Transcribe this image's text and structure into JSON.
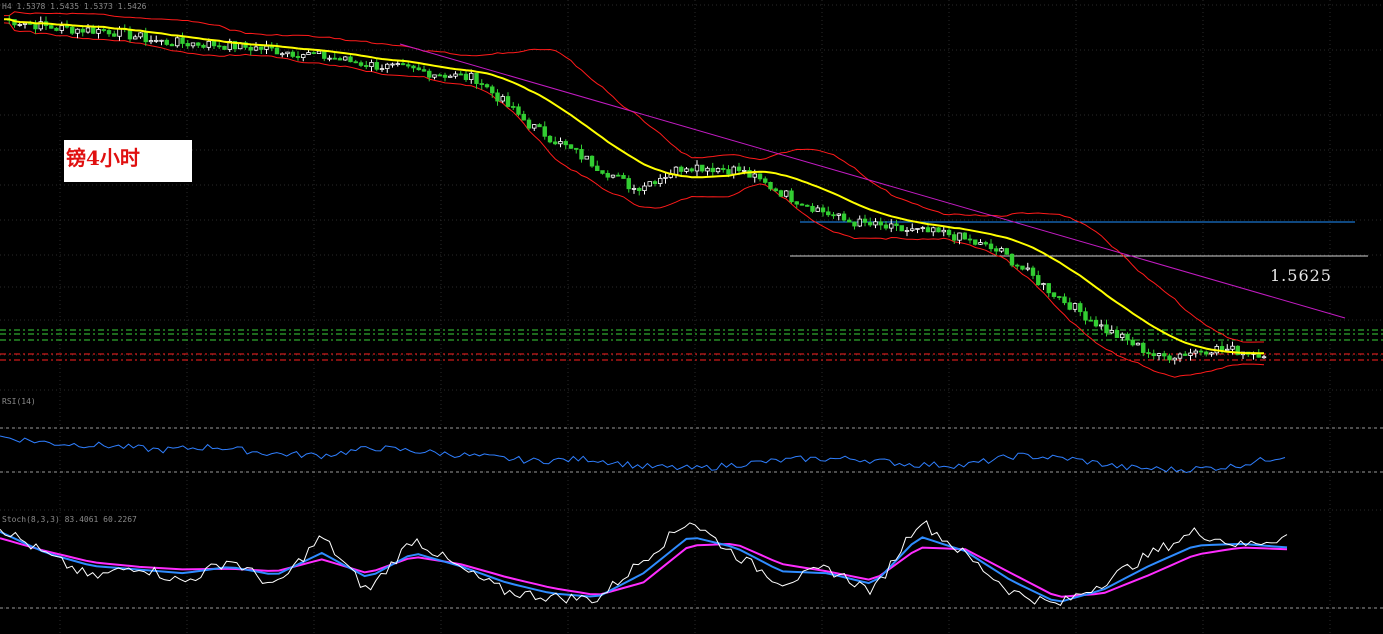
{
  "annotation": {
    "label": "镑4小时",
    "price_label": "1.5625"
  },
  "headers": {
    "main": "H4  1.5378 1.5435 1.5373 1.5426",
    "rsi": "RSI(14)",
    "stoch": "Stoch(8,3,3) 83.4061 60.2267"
  },
  "colors": {
    "candle_up": "#ffffff",
    "candle_down": "#32cd32",
    "moving_average": "#ffff00",
    "bollinger_bands": "#ff1a1a",
    "trendline": "#c21bc2",
    "horizontal_level_blue": "#1e90ff",
    "horizontal_level_white": "#d0d0d0",
    "rsi_line": "#2f7fff",
    "stoch_main": "#ffffff",
    "stoch_signal_1": "#2f8cff",
    "stoch_signal_2": "#ff2cff",
    "level_green": "#3ad23a",
    "level_red": "#ff2020",
    "grid": "#2a2a2a"
  },
  "chart_data": [
    {
      "type": "candlestick",
      "panel": "price",
      "indicators": [
        "moving average",
        "bollinger bands",
        "trendline",
        "horizontal levels"
      ],
      "trend": [
        {
          "x": 0,
          "close": 1.616
        },
        {
          "x": 10,
          "close": 1.614
        },
        {
          "x": 20,
          "close": 1.6135
        },
        {
          "x": 30,
          "close": 1.611
        },
        {
          "x": 40,
          "close": 1.6105
        },
        {
          "x": 50,
          "close": 1.6095
        },
        {
          "x": 60,
          "close": 1.608
        },
        {
          "x": 70,
          "close": 1.606
        },
        {
          "x": 80,
          "close": 1.6045
        },
        {
          "x": 90,
          "close": 1.603
        },
        {
          "x": 100,
          "close": 1.593
        },
        {
          "x": 110,
          "close": 1.586
        },
        {
          "x": 120,
          "close": 1.579
        },
        {
          "x": 130,
          "close": 1.584
        },
        {
          "x": 140,
          "close": 1.583
        },
        {
          "x": 150,
          "close": 1.577
        },
        {
          "x": 160,
          "close": 1.572
        },
        {
          "x": 170,
          "close": 1.57
        },
        {
          "x": 180,
          "close": 1.569
        },
        {
          "x": 190,
          "close": 1.565
        },
        {
          "x": 200,
          "close": 1.556
        },
        {
          "x": 210,
          "close": 1.548
        },
        {
          "x": 220,
          "close": 1.542
        },
        {
          "x": 230,
          "close": 1.544
        },
        {
          "x": 240,
          "close": 1.543
        }
      ],
      "price_label": 1.5625
    },
    {
      "type": "line",
      "panel": "rsi",
      "values": [
        62,
        56,
        54,
        50,
        53,
        47,
        45,
        52,
        48,
        44,
        40,
        42,
        35,
        33,
        38,
        42,
        42,
        37,
        36,
        45,
        42,
        34,
        32,
        35,
        45
      ]
    },
    {
      "type": "line",
      "panel": "stochastic",
      "series": [
        {
          "values": [
            90,
            60,
            35,
            48,
            30,
            55,
            25,
            80,
            20,
            78,
            45,
            20,
            14,
            12,
            55,
            98,
            60,
            30,
            45,
            20,
            98,
            60,
            20,
            5,
            30,
            60,
            85,
            70,
            80
          ]
        },
        {
          "values": [
            85,
            62,
            48,
            44,
            40,
            47,
            38,
            62,
            35,
            62,
            48,
            30,
            18,
            14,
            40,
            80,
            68,
            42,
            40,
            28,
            80,
            64,
            32,
            8,
            22,
            48,
            70,
            72,
            68
          ]
        },
        {
          "values": [
            78,
            64,
            52,
            47,
            44,
            45,
            42,
            55,
            40,
            58,
            50,
            36,
            24,
            16,
            30,
            70,
            72,
            50,
            42,
            32,
            68,
            66,
            40,
            14,
            18,
            38,
            60,
            68,
            66
          ]
        }
      ]
    }
  ]
}
